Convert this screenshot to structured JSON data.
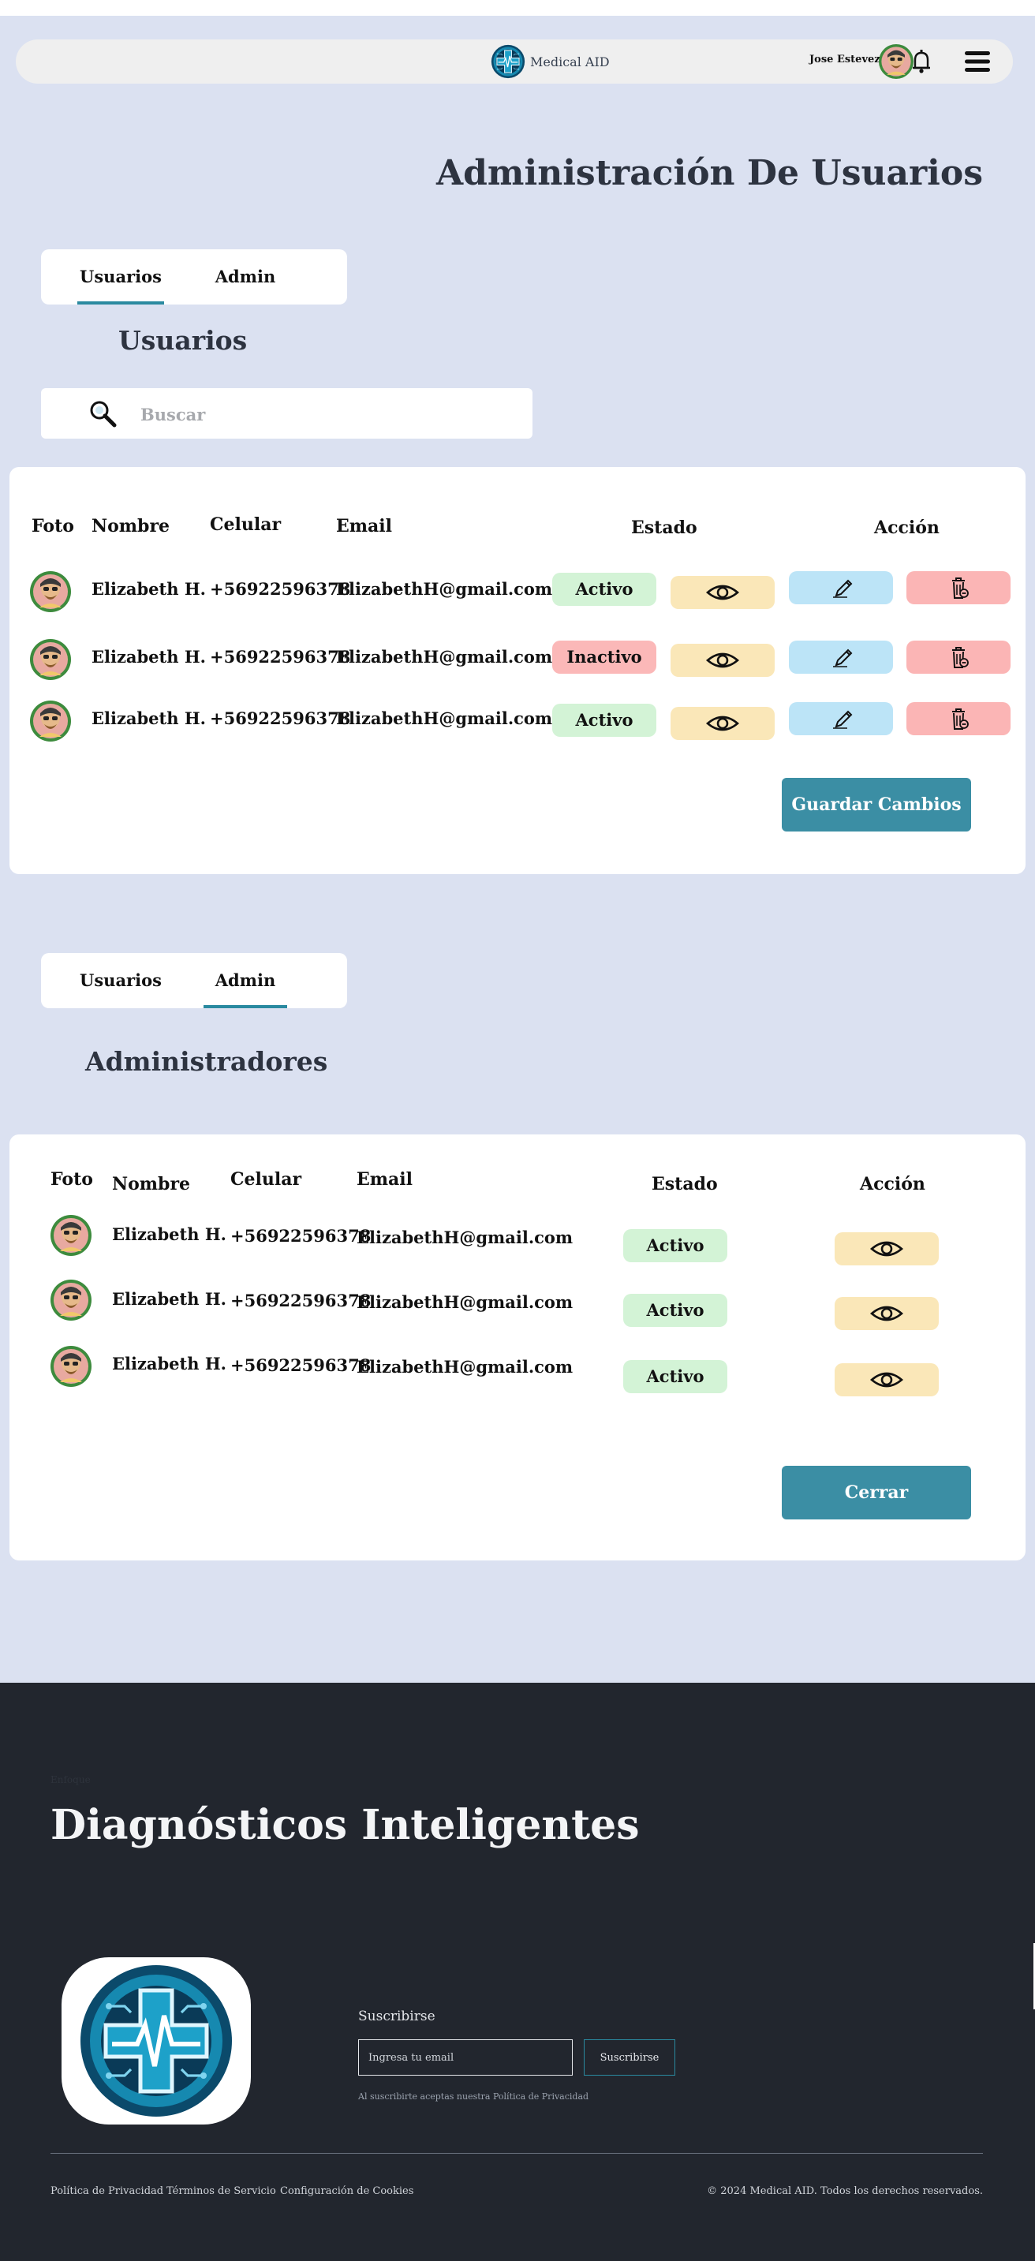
{
  "app": {
    "brand_name": "Medical AID",
    "user_name": "Jose Estevez",
    "page_title": "Administración De Usuarios"
  },
  "icons": {
    "logo": "medical-cross-logo",
    "bell": "bell-icon",
    "menu": "hamburger-menu-icon",
    "search": "magnifier-icon",
    "view": "eye-icon",
    "edit": "pencil-icon",
    "delete": "trash-icon"
  },
  "colors": {
    "accent": "#3b8ea4",
    "page_bg": "#dbe1f1",
    "footer_bg": "#22262e",
    "status_active": "#d3f3d6",
    "status_inactive": "#fbb8b8",
    "view_btn": "#fae7b8",
    "edit_btn": "#bce4f7",
    "delete_btn": "#fbb5b5"
  },
  "tabs": [
    "Usuarios",
    "Admin"
  ],
  "users_section": {
    "active_tab": "Usuarios",
    "title": "Usuarios",
    "search_placeholder": "Buscar",
    "headers": {
      "photo": "Foto",
      "name": "Nombre",
      "phone": "Celular",
      "email": "Email",
      "status": "Estado",
      "action": "Acción"
    },
    "rows": [
      {
        "name": "Elizabeth H.",
        "phone": "+56922596378",
        "email": "ElizabethH@gmail.com",
        "status": "Activo"
      },
      {
        "name": "Elizabeth H.",
        "phone": "+56922596378",
        "email": "ElizabethH@gmail.com",
        "status": "Inactivo"
      },
      {
        "name": "Elizabeth H.",
        "phone": "+56922596378",
        "email": "ElizabethH@gmail.com",
        "status": "Activo"
      }
    ],
    "save_button": "Guardar Cambios"
  },
  "admins_section": {
    "active_tab": "Admin",
    "title": "Administradores",
    "headers": {
      "photo": "Foto",
      "name": "Nombre",
      "phone": "Celular",
      "email": "Email",
      "status": "Estado",
      "action": "Acción"
    },
    "rows": [
      {
        "name": "Elizabeth H.",
        "phone": "+56922596378",
        "email": "ElizabethH@gmail.com",
        "status": "Activo"
      },
      {
        "name": "Elizabeth H.",
        "phone": "+56922596378",
        "email": "ElizabethH@gmail.com",
        "status": "Activo"
      },
      {
        "name": "Elizabeth H.",
        "phone": "+56922596378",
        "email": "ElizabethH@gmail.com",
        "status": "Activo"
      }
    ],
    "close_button": "Cerrar"
  },
  "footer": {
    "kicker": "Enfoque",
    "title": "Diagnósticos Inteligentes",
    "subscribe_label": "Suscribirse",
    "email_placeholder": "Ingresa tu email",
    "subscribe_button": "Suscribirse",
    "privacy_note": "Al suscribirte aceptas nuestra Política de Privacidad",
    "links": [
      "Política de Privacidad",
      "Términos de Servicio",
      "Configuración de Cookies"
    ],
    "copyright": "© 2024 Medical AID. Todos los derechos reservados."
  }
}
